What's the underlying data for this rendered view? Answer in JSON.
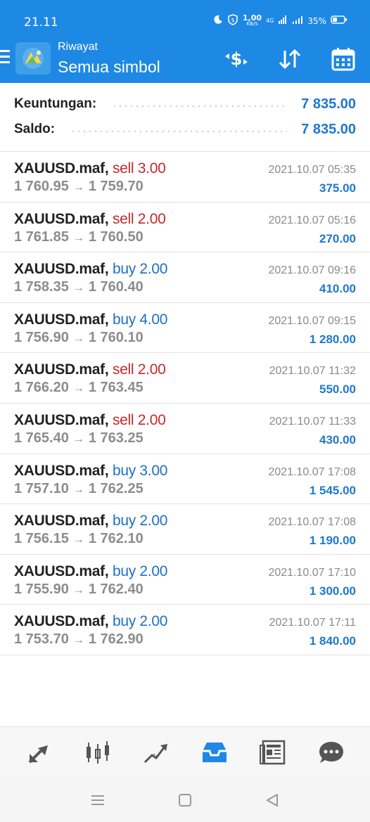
{
  "status_bar": {
    "time": "21.11",
    "net_speed": "1,00",
    "net_unit": "KB/S",
    "signal_label": "4G",
    "battery": "35%"
  },
  "app_bar": {
    "subtitle": "Riwayat",
    "title": "Semua simbol",
    "icons": [
      "menu-icon",
      "currency-exchange-icon",
      "sort-icon",
      "calendar-icon"
    ]
  },
  "summary": {
    "profit_label": "Keuntungan:",
    "profit_value": "7 835.00",
    "balance_label": "Saldo:",
    "balance_value": "7 835.00"
  },
  "deals": [
    {
      "symbol": "XAUUSD.maf,",
      "type": "sell",
      "type_label": "sell 3.00",
      "open": "1 760.95",
      "arrow": "→",
      "close": "1 759.70",
      "time": "2021.10.07 05:35",
      "profit": "375.00"
    },
    {
      "symbol": "XAUUSD.maf,",
      "type": "sell",
      "type_label": "sell 2.00",
      "open": "1 761.85",
      "arrow": "→",
      "close": "1 760.50",
      "time": "2021.10.07 05:16",
      "profit": "270.00"
    },
    {
      "symbol": "XAUUSD.maf,",
      "type": "buy",
      "type_label": "buy 2.00",
      "open": "1 758.35",
      "arrow": "→",
      "close": "1 760.40",
      "time": "2021.10.07 09:16",
      "profit": "410.00"
    },
    {
      "symbol": "XAUUSD.maf,",
      "type": "buy",
      "type_label": "buy 4.00",
      "open": "1 756.90",
      "arrow": "→",
      "close": "1 760.10",
      "time": "2021.10.07 09:15",
      "profit": "1 280.00"
    },
    {
      "symbol": "XAUUSD.maf,",
      "type": "sell",
      "type_label": "sell 2.00",
      "open": "1 766.20",
      "arrow": "→",
      "close": "1 763.45",
      "time": "2021.10.07 11:32",
      "profit": "550.00"
    },
    {
      "symbol": "XAUUSD.maf,",
      "type": "sell",
      "type_label": "sell 2.00",
      "open": "1 765.40",
      "arrow": "→",
      "close": "1 763.25",
      "time": "2021.10.07 11:33",
      "profit": "430.00"
    },
    {
      "symbol": "XAUUSD.maf,",
      "type": "buy",
      "type_label": "buy 3.00",
      "open": "1 757.10",
      "arrow": "→",
      "close": "1 762.25",
      "time": "2021.10.07 17:08",
      "profit": "1 545.00"
    },
    {
      "symbol": "XAUUSD.maf,",
      "type": "buy",
      "type_label": "buy 2.00",
      "open": "1 756.15",
      "arrow": "→",
      "close": "1 762.10",
      "time": "2021.10.07 17:08",
      "profit": "1 190.00"
    },
    {
      "symbol": "XAUUSD.maf,",
      "type": "buy",
      "type_label": "buy 2.00",
      "open": "1 755.90",
      "arrow": "→",
      "close": "1 762.40",
      "time": "2021.10.07 17:10",
      "profit": "1 300.00"
    },
    {
      "symbol": "XAUUSD.maf,",
      "type": "buy",
      "type_label": "buy 2.00",
      "open": "1 753.70",
      "arrow": "→",
      "close": "1 762.90",
      "time": "2021.10.07 17:11",
      "profit": "1 840.00"
    }
  ],
  "bottom_nav": {
    "items": [
      "quotes-icon",
      "chart-icon",
      "trade-icon",
      "history-icon",
      "news-icon",
      "chat-icon"
    ],
    "active": "history-icon"
  },
  "system_nav": [
    "recent-apps-icon",
    "home-icon",
    "back-icon"
  ],
  "colors": {
    "accent": "#1e88e5",
    "sell": "#c62828",
    "buy": "#1e6fc8",
    "profit": "#1e78d0"
  }
}
